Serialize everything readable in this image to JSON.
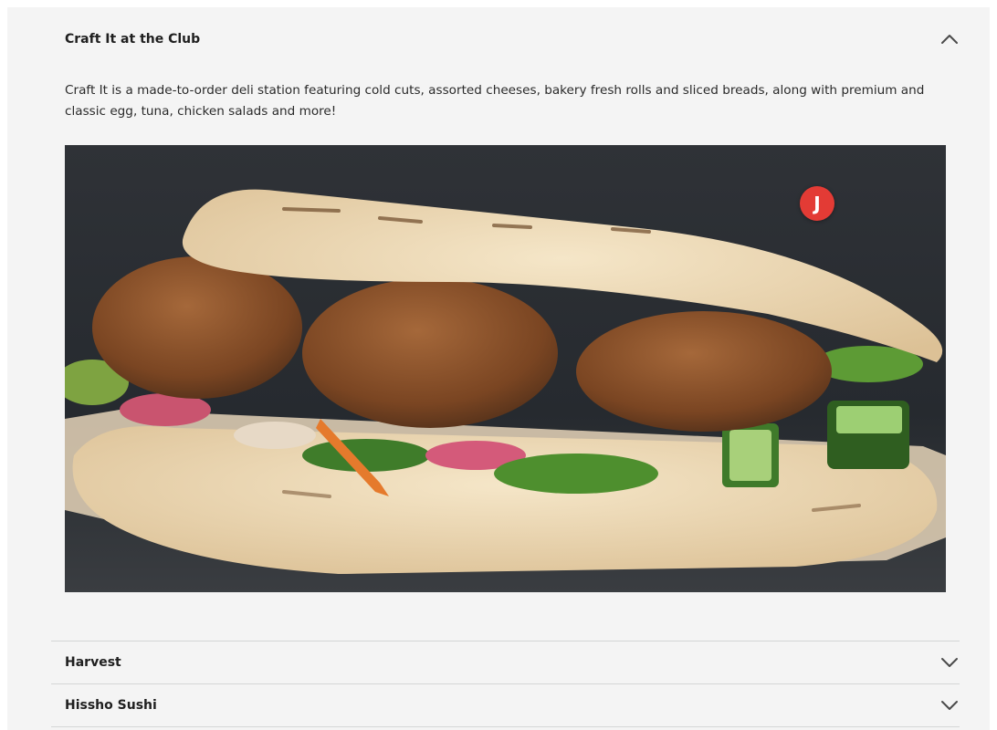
{
  "sections": [
    {
      "title": "Craft It at the Club",
      "expanded": true,
      "description": "Craft It is a made-to-order deli station featuring cold cuts, assorted cheeses, bakery fresh rolls and sliced breads, along with premium and classic egg, tuna, chicken salads and more!",
      "image_subject": "falafel-pita-sandwich",
      "toggle_icon": "chevron-up-icon"
    },
    {
      "title": "Harvest",
      "expanded": false,
      "toggle_icon": "chevron-down-icon"
    },
    {
      "title": "Hissho Sushi",
      "expanded": false,
      "toggle_icon": "chevron-down-icon"
    }
  ],
  "overlay_badge": {
    "initial": "J",
    "color": "#e33b35"
  },
  "colors": {
    "panel_background": "#f4f4f4",
    "divider": "#d4d6d6",
    "text": "#1f1f1f"
  }
}
